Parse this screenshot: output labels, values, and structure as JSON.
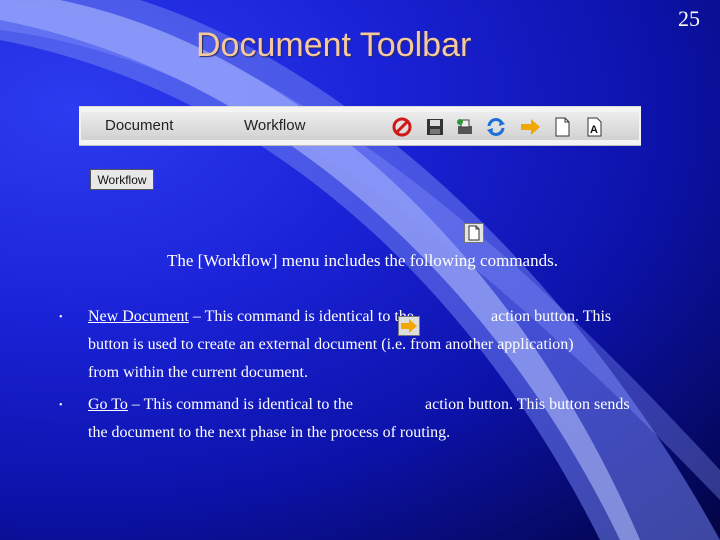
{
  "slide": {
    "page_number": "25",
    "title": "Document Toolbar"
  },
  "toolbar": {
    "menus": [
      "Document",
      "Workflow"
    ],
    "icons": [
      "cancel-icon",
      "save-icon",
      "print-icon",
      "refresh-icon",
      "goto-arrow-icon",
      "new-document-icon",
      "properties-icon"
    ]
  },
  "workflow_button": {
    "label": "Workflow"
  },
  "body": {
    "intro": "The [Workflow] menu includes the following commands.",
    "bullets": [
      {
        "term": "New Document",
        "line1": " – This command is identical to the",
        "line1_tail": "action button.  This",
        "line2": "button is used to create an external document (i.e. from another application)",
        "line3": "from within the current document."
      },
      {
        "term": "Go To",
        "line1": " – This command is identical to the",
        "line1_tail": "action button.  This button sends",
        "line2": "the document to the next phase in the process of routing."
      }
    ]
  },
  "colors": {
    "title": "#f6c99d",
    "text": "#ffffff",
    "background": "#1a22d6"
  }
}
